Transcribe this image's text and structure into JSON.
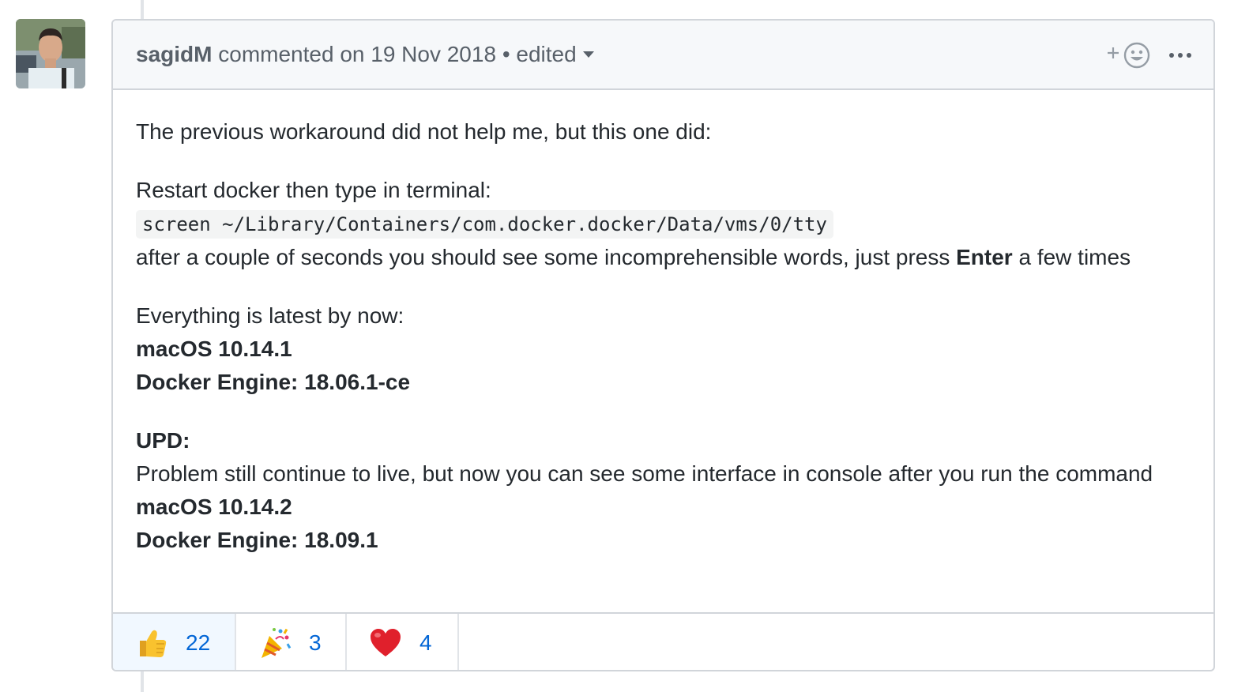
{
  "comment": {
    "author": "sagidM",
    "action_text": "commented on 19 Nov 2018",
    "separator": "•",
    "edited_label": "edited",
    "add_reaction_symbol": "+",
    "more_symbol": "•••"
  },
  "body": {
    "p1": "The previous workaround did not help me, but this one did:",
    "p2_line1": "Restart docker then type in terminal:",
    "p2_code": "screen ~/Library/Containers/com.docker.docker/Data/vms/0/tty",
    "p2_line3_pre": "after a couple of seconds you should see some incomprehensible words, just press ",
    "p2_line3_bold": "Enter",
    "p2_line3_post": " a few times",
    "p3_line1": "Everything is latest by now:",
    "p3_line2": "macOS 10.14.1",
    "p3_line3": "Docker Engine: 18.06.1-ce",
    "p4_line1": "UPD:",
    "p4_line2": "Problem still continue to live, but now you can see some interface in console after you run the command",
    "p4_line3": "macOS 10.14.2",
    "p4_line4": "Docker Engine: 18.09.1"
  },
  "reactions": [
    {
      "icon": "thumbs-up-icon",
      "count": "22",
      "selected": true
    },
    {
      "icon": "party-popper-icon",
      "count": "3",
      "selected": false
    },
    {
      "icon": "heart-icon",
      "count": "4",
      "selected": false
    }
  ],
  "colors": {
    "header_bg": "#f6f8fa",
    "border": "#d1d5da",
    "link_blue": "#0366d6",
    "muted_text": "#586069",
    "selected_reaction_bg": "#f1f8ff"
  }
}
